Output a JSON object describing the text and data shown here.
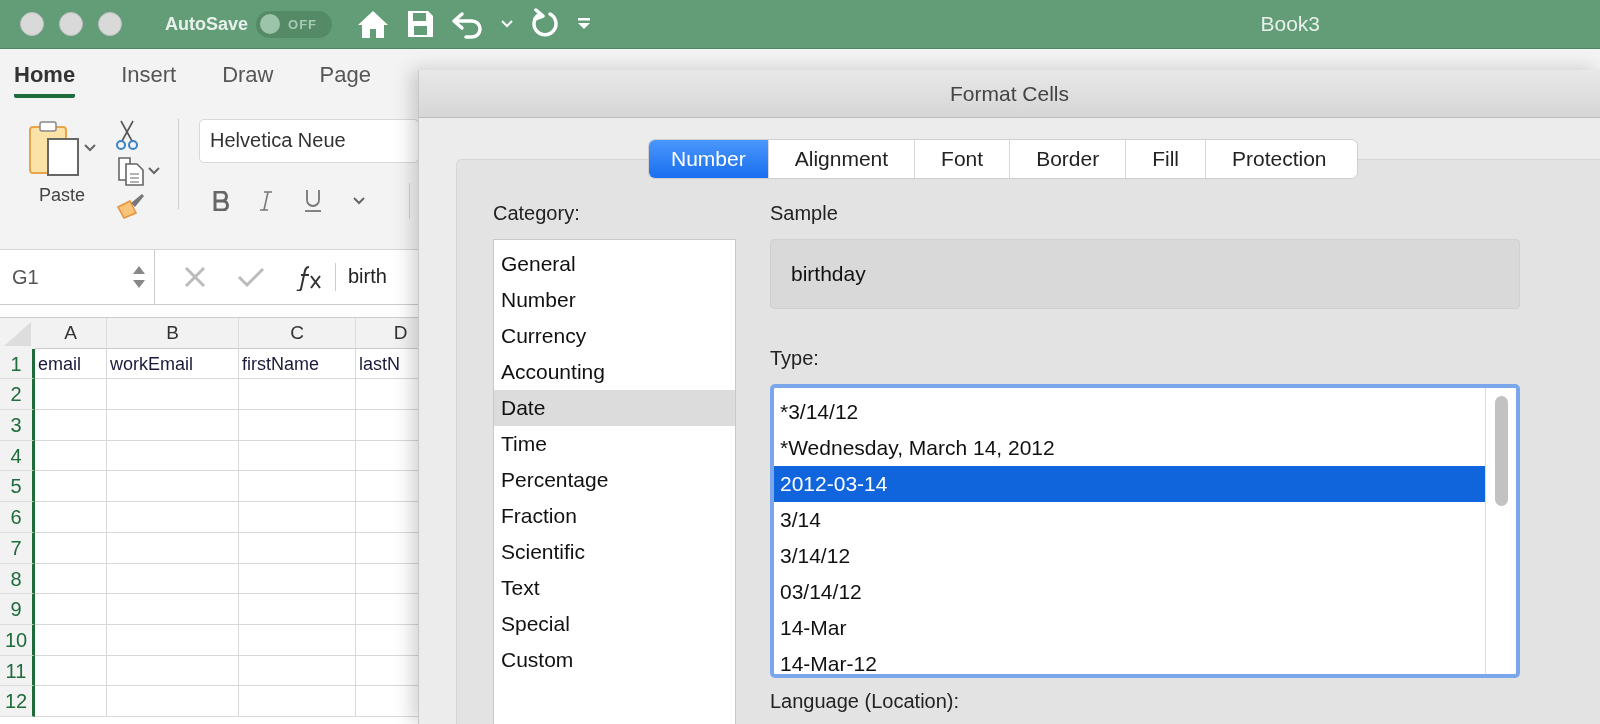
{
  "window": {
    "title": "Book3"
  },
  "autosave": {
    "label": "AutoSave",
    "state_label": "OFF",
    "on": false
  },
  "ribbon_tabs": [
    {
      "label": "Home",
      "selected": true
    },
    {
      "label": "Insert",
      "selected": false
    },
    {
      "label": "Draw",
      "selected": false
    },
    {
      "label": "Page",
      "selected": false
    }
  ],
  "clipboard": {
    "paste_label": "Paste"
  },
  "font": {
    "name": "Helvetica Neue"
  },
  "formula_bar": {
    "name_box": "G1",
    "content": "birth"
  },
  "sheet": {
    "columns": [
      "A",
      "B",
      "C",
      "D"
    ],
    "rows": [
      {
        "header": "1",
        "cells": [
          "email",
          "workEmail",
          "firstName",
          "lastN"
        ]
      },
      {
        "header": "2"
      },
      {
        "header": "3"
      },
      {
        "header": "4"
      },
      {
        "header": "5"
      },
      {
        "header": "6"
      },
      {
        "header": "7"
      },
      {
        "header": "8"
      },
      {
        "header": "9"
      },
      {
        "header": "10"
      },
      {
        "header": "11"
      },
      {
        "header": "12"
      }
    ]
  },
  "dialog": {
    "title": "Format Cells",
    "tabs": [
      {
        "label": "Number",
        "selected": true
      },
      {
        "label": "Alignment",
        "selected": false
      },
      {
        "label": "Font",
        "selected": false
      },
      {
        "label": "Border",
        "selected": false
      },
      {
        "label": "Fill",
        "selected": false
      },
      {
        "label": "Protection",
        "selected": false
      }
    ],
    "category_label": "Category:",
    "categories": [
      {
        "label": "General",
        "selected": false
      },
      {
        "label": "Number",
        "selected": false
      },
      {
        "label": "Currency",
        "selected": false
      },
      {
        "label": "Accounting",
        "selected": false
      },
      {
        "label": "Date",
        "selected": true
      },
      {
        "label": "Time",
        "selected": false
      },
      {
        "label": "Percentage",
        "selected": false
      },
      {
        "label": "Fraction",
        "selected": false
      },
      {
        "label": "Scientific",
        "selected": false
      },
      {
        "label": "Text",
        "selected": false
      },
      {
        "label": "Special",
        "selected": false
      },
      {
        "label": "Custom",
        "selected": false
      }
    ],
    "sample_label": "Sample",
    "sample_value": "birthday",
    "type_label": "Type:",
    "types": [
      {
        "label": "*3/14/12",
        "selected": false
      },
      {
        "label": "*Wednesday, March 14, 2012",
        "selected": false
      },
      {
        "label": "2012-03-14",
        "selected": true
      },
      {
        "label": "3/14",
        "selected": false
      },
      {
        "label": "3/14/12",
        "selected": false
      },
      {
        "label": "03/14/12",
        "selected": false
      },
      {
        "label": "14-Mar",
        "selected": false
      },
      {
        "label": "14-Mar-12",
        "selected": false
      }
    ],
    "language_label": "Language (Location):"
  }
}
